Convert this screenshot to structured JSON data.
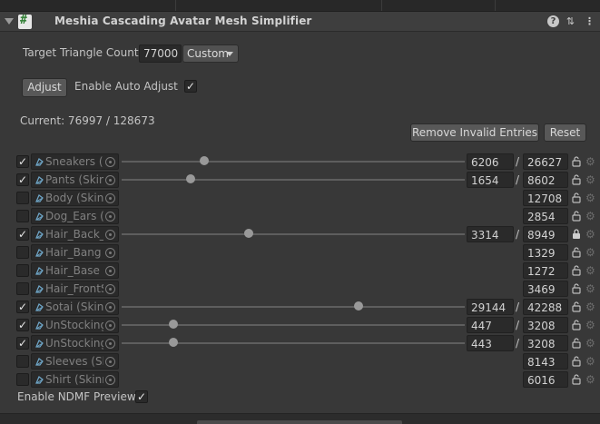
{
  "header": {
    "title": "Meshia Cascading Avatar Mesh Simplifier"
  },
  "target": {
    "label": "Target Triangle Count",
    "value": "77000",
    "mode": "Custom"
  },
  "adjust": {
    "button_label": "Adjust",
    "auto_label": "Enable Auto Adjust",
    "auto_checked": true
  },
  "current": {
    "text": "Current: 76997 / 128673"
  },
  "actions": {
    "remove_label": "Remove Invalid Entries",
    "reset_label": "Reset"
  },
  "rows": [
    {
      "name": "Sneakers (S",
      "enabled": true,
      "slider": 0.24,
      "value": "6206",
      "max": "26627",
      "locked": false
    },
    {
      "name": "Pants (Skin",
      "enabled": true,
      "slider": 0.2,
      "value": "1654",
      "max": "8602",
      "locked": false
    },
    {
      "name": "Body (Skinr",
      "enabled": false,
      "max": "12708",
      "locked": false
    },
    {
      "name": "Dog_Ears (S",
      "enabled": false,
      "max": "2854",
      "locked": false
    },
    {
      "name": "Hair_Back_S",
      "enabled": true,
      "slider": 0.37,
      "value": "3314",
      "max": "8949",
      "locked": true
    },
    {
      "name": "Hair_Bang (",
      "enabled": false,
      "max": "1329",
      "locked": false
    },
    {
      "name": "Hair_Base (",
      "enabled": false,
      "max": "1272",
      "locked": false
    },
    {
      "name": "Hair_FrontS",
      "enabled": false,
      "max": "3469",
      "locked": false
    },
    {
      "name": "Sotai (Skinr",
      "enabled": true,
      "slider": 0.69,
      "value": "29144",
      "max": "42288",
      "locked": false
    },
    {
      "name": "UnStocking",
      "enabled": true,
      "slider": 0.15,
      "value": "447",
      "max": "3208",
      "locked": false
    },
    {
      "name": "UnStocking",
      "enabled": true,
      "slider": 0.15,
      "value": "443",
      "max": "3208",
      "locked": false
    },
    {
      "name": "Sleeves (Sk",
      "enabled": false,
      "max": "8143",
      "locked": false
    },
    {
      "name": "Shirt (Skinn",
      "enabled": false,
      "max": "6016",
      "locked": false
    }
  ],
  "preview": {
    "label": "Enable NDMF Preview",
    "checked": true
  },
  "icons": {
    "fold": "foldout-triangle-icon",
    "script": "csharp-script-icon",
    "help": "help-icon",
    "presets": "presets-icon",
    "more": "more-menu-icon",
    "mesh": "skinned-mesh-icon",
    "picker": "object-picker-icon",
    "lock": "lock-icon",
    "gear": "gear-icon"
  }
}
